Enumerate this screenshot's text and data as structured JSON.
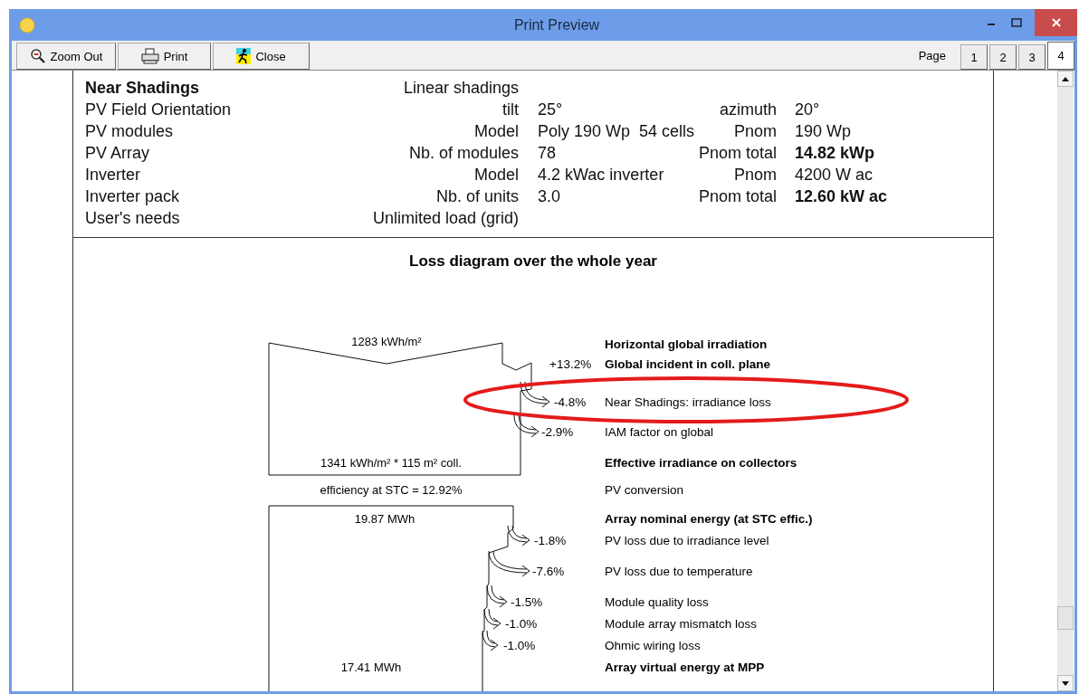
{
  "window": {
    "title": "Print Preview"
  },
  "toolbar": [
    {
      "kind": "zoom-out",
      "label": "Zoom Out"
    },
    {
      "kind": "print",
      "label": "Print"
    },
    {
      "kind": "close",
      "label": "Close"
    }
  ],
  "page_nav": {
    "label": "Page",
    "pages": [
      {
        "label": "1",
        "selected": false
      },
      {
        "label": "2",
        "selected": false
      },
      {
        "label": "3",
        "selected": false
      },
      {
        "label": "4",
        "selected": true
      }
    ]
  },
  "parameters": [
    {
      "label": "Near Shadings",
      "bold": true,
      "value": "Linear shadings"
    },
    {
      "label": "PV Field Orientation",
      "bold": false,
      "field": "tilt",
      "value": "25°",
      "field2": "azimuth",
      "value2": "20°",
      "value2_bold": false
    },
    {
      "label": "PV modules",
      "bold": false,
      "field": "Model",
      "value": "Poly 190 Wp  54 cells",
      "field2": "Pnom",
      "value2": "190 Wp",
      "value2_bold": false
    },
    {
      "label": "PV Array",
      "bold": false,
      "field": "Nb. of modules",
      "value": "78",
      "field2": "Pnom total",
      "value2": "14.82 kWp",
      "value2_bold": true
    },
    {
      "label": "Inverter",
      "bold": false,
      "field": "Model",
      "value": "4.2 kWac inverter",
      "field2": "Pnom",
      "value2": "4200 W ac",
      "value2_bold": false
    },
    {
      "label": "Inverter pack",
      "bold": false,
      "field": "Nb. of units",
      "value": "3.0",
      "field2": "Pnom total",
      "value2": "12.60 kW ac",
      "value2_bold": true
    },
    {
      "label": "User's needs",
      "bold": false,
      "value": "Unlimited load (grid)"
    }
  ],
  "loss_diagram": {
    "title": "Loss diagram over the whole year",
    "values": [
      "1283 kWh/m²",
      "1341 kWh/m² * 115 m² coll.",
      "efficiency at STC = 12.92%",
      "19.87 MWh",
      "17.41 MWh"
    ],
    "steps": [
      {
        "kind": "label",
        "label": "Horizontal global irradiation",
        "bold": true
      },
      {
        "kind": "gain",
        "percent": "+13.2%",
        "label": "Global incident in coll. plane",
        "bold": true
      },
      {
        "kind": "loss",
        "percent": "-4.8%",
        "label": "Near Shadings: irradiance loss",
        "bold": false
      },
      {
        "kind": "loss",
        "percent": "-2.9%",
        "label": "IAM factor on global",
        "bold": false
      },
      {
        "kind": "label",
        "label": "Effective irradiance on collectors",
        "bold": true
      },
      {
        "kind": "label",
        "label": "PV conversion",
        "bold": false
      },
      {
        "kind": "label",
        "label": "Array nominal energy (at STC effic.)",
        "bold": true
      },
      {
        "kind": "loss",
        "percent": "-1.8%",
        "label": "PV loss due to irradiance level",
        "bold": false
      },
      {
        "kind": "loss",
        "percent": "-7.6%",
        "label": "PV loss due to temperature",
        "bold": false
      },
      {
        "kind": "loss",
        "percent": "-1.5%",
        "label": "Module quality loss",
        "bold": false
      },
      {
        "kind": "loss",
        "percent": "-1.0%",
        "label": "Module array mismatch loss",
        "bold": false
      },
      {
        "kind": "loss",
        "percent": "-1.0%",
        "label": "Ohmic wiring loss",
        "bold": false
      },
      {
        "kind": "label",
        "label": "Array virtual energy at MPP",
        "bold": true
      }
    ]
  }
}
